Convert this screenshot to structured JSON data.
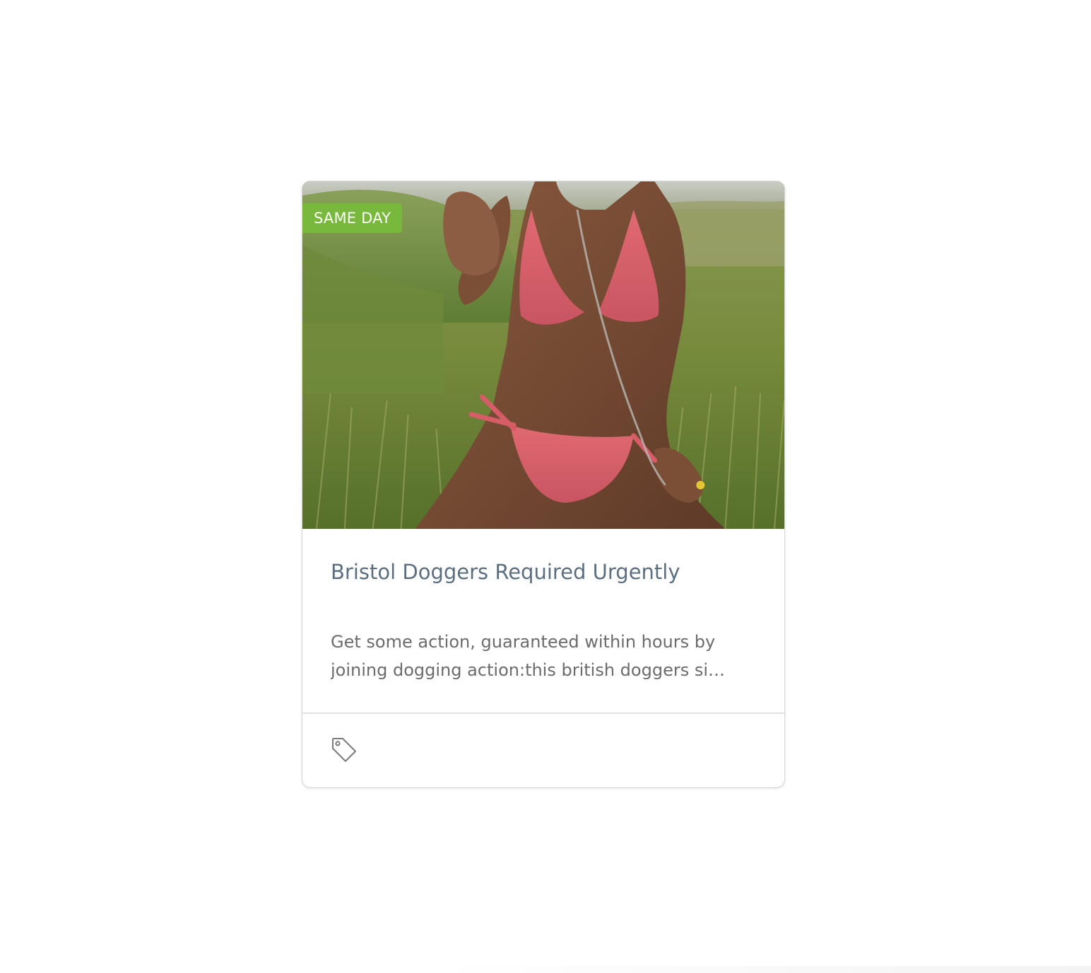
{
  "card": {
    "badge_label": "SAME DAY",
    "title": "Bristol Doggers Required Urgently",
    "excerpt_lines": [
      "Get some action, guaranteed within hours by",
      "joining dogging action:this british doggers si…"
    ],
    "image_alt": "Photo of a person in a pink bikini kneeling in a grassy field",
    "footer_icon": "tag-icon"
  },
  "colors": {
    "badge": "#78b83c",
    "title": "#5b6f80",
    "excerpt": "#6b6b6b"
  }
}
